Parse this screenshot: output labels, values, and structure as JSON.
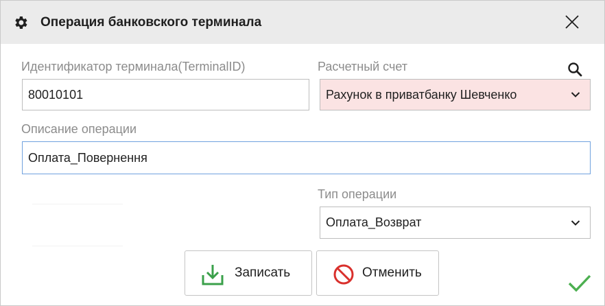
{
  "window": {
    "title": "Операция банковского терминала",
    "icon": "gear-icon",
    "close_icon": "close-icon"
  },
  "form": {
    "terminal_id": {
      "label": "Идентификатор терминала(TerminalID)",
      "value": "80010101"
    },
    "account": {
      "label": "Расчетный счет",
      "value": "Рахунок в приватбанку Шевченко",
      "search_icon": "search-icon",
      "state_color": "#fbe3e3"
    },
    "description": {
      "label": "Описание операции",
      "value": "Оплата_Повернення"
    },
    "operation_type": {
      "label": "Тип операции",
      "value": "Оплата_Возврат"
    }
  },
  "buttons": {
    "save": {
      "label": "Записать",
      "icon": "download-icon",
      "color": "#3aa04a"
    },
    "cancel": {
      "label": "Отменить",
      "icon": "prohibited-icon",
      "color": "#d9302c"
    },
    "ok": {
      "icon": "checkmark-icon",
      "color": "#4caf50"
    }
  }
}
